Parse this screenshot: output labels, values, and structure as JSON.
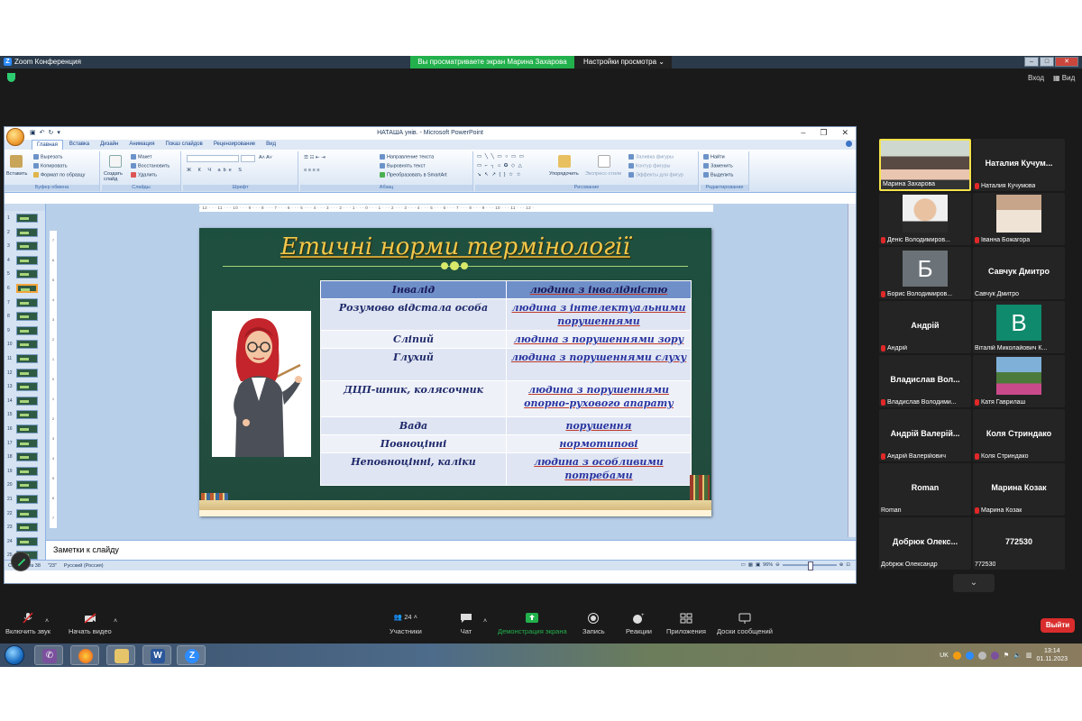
{
  "zoom": {
    "app_title": "Zoom Конференция",
    "share_banner": "Вы просматриваете экран Марина Захарова",
    "view_settings": "Настройки просмотра",
    "view_label": "Вход",
    "grid_label": "Вид"
  },
  "ppt": {
    "window_title": "НАТАША унів. - Microsoft PowerPoint",
    "tabs": [
      "Главная",
      "Вставка",
      "Дизайн",
      "Анимация",
      "Показ слайдов",
      "Рецензирование",
      "Вид"
    ],
    "ribbon": {
      "paste": "Вставить",
      "cut": "Вырезать",
      "copy": "Копировать",
      "format_painter": "Формат по образцу",
      "clipboard_group": "Буфер обмена",
      "new_slide": "Создать слайд",
      "layout": "Макет",
      "reset": "Восстановить",
      "delete": "Удалить",
      "slides_group": "Слайды",
      "font_group": "Шрифт",
      "text_direction": "Направление текста",
      "align_text": "Выровнять текст",
      "smartart": "Преобразовать в SmartArt",
      "paragraph_group": "Абзац",
      "arrange": "Упорядочить",
      "quick_styles": "Экспресс-стили",
      "shape_fill": "Заливка фигуры",
      "shape_outline": "Контур фигуры",
      "shape_effects": "Эффекты для фигур",
      "drawing_group": "Рисование",
      "find": "Найти",
      "replace": "Заменить",
      "select": "Выделить",
      "editing_group": "Редактирование"
    },
    "hruler_text": "· 12 · · · 11 · · · 10 · · · 9 · · · 8 · · · 7 · · · 6 · · · 5 · · · 4 · · · 3 · · · 2 · · · 1 · · · 0 · · · 1 · · · 2 · · · 3 · · · 4 · · · 5 · · · 6 · · · 7 · · · 8 · · · 9 · · · 10 · · · 11 · · · 12 ·",
    "thumbnails": [
      "1",
      "2",
      "3",
      "4",
      "5",
      "6",
      "7",
      "8",
      "9",
      "10",
      "11",
      "12",
      "13",
      "14",
      "15",
      "16",
      "17",
      "18",
      "19",
      "20",
      "21",
      "22",
      "23",
      "24",
      "25"
    ],
    "active_thumbnail": "6",
    "slide": {
      "title": "Етичні норми термінології",
      "table": [
        [
          "Інвалід",
          "людина з інвалідністю"
        ],
        [
          "Розумово  відстала особа",
          "людина з інтелектуальними порушеннями"
        ],
        [
          "Сліпий",
          "людина з порушеннями зору"
        ],
        [
          "Глухий",
          "людина з порушеннями слуху"
        ],
        [
          "ДЦП-шник,  колясочник",
          "людина з порушеннями опорно-рухового апарату"
        ],
        [
          "Вада",
          "порушення"
        ],
        [
          "Повноцінні",
          "нормотипові"
        ],
        [
          "Неповноцінні, каліки",
          "людина з особливими потребами"
        ]
      ]
    },
    "notes_placeholder": "Заметки к слайду",
    "status": {
      "slide_of": "Слайд 6 из 38",
      "theme": "\"23\"",
      "language": "Русский (Россия)",
      "zoom": "96%"
    }
  },
  "participants": [
    {
      "center": "",
      "label": "Марина Захарова",
      "muted": false,
      "kind": "photo",
      "active": true
    },
    {
      "center": "Наталия  Кучум...",
      "label": "Наталия Кучумова",
      "muted": true,
      "kind": "name"
    },
    {
      "center": "",
      "label": "Деніс Володимиров...",
      "muted": true,
      "kind": "photo2"
    },
    {
      "center": "",
      "label": "Іванна Божагора",
      "muted": true,
      "kind": "photo3"
    },
    {
      "center": "Б",
      "label": "Борис Володимиров...",
      "muted": true,
      "kind": "letter",
      "color": "#6b7278"
    },
    {
      "center": "Савчук Дмитро",
      "label": "Савчук Дмитро",
      "muted": false,
      "kind": "name"
    },
    {
      "center": "Андрій",
      "label": "Андрій",
      "muted": true,
      "kind": "name"
    },
    {
      "center": "В",
      "label": "Віталій Миколайович К...",
      "muted": false,
      "kind": "letter",
      "color": "#0f8a6c"
    },
    {
      "center": "Владислав  Вол...",
      "label": "Владислав Володими...",
      "muted": true,
      "kind": "name"
    },
    {
      "center": "",
      "label": "Катя Гаврилаш",
      "muted": true,
      "kind": "photo4"
    },
    {
      "center": "Андрій  Валерій...",
      "label": "Андрій Валерійович",
      "muted": true,
      "kind": "name"
    },
    {
      "center": "Коля  Стриндако",
      "label": "Коля Стриндако",
      "muted": true,
      "kind": "name"
    },
    {
      "center": "Roman",
      "label": "Roman",
      "muted": false,
      "kind": "name"
    },
    {
      "center": "Марина  Козак",
      "label": "Марина Козак",
      "muted": true,
      "kind": "name"
    },
    {
      "center": "Добрюк  Олекс...",
      "label": "Добрюк Олександр",
      "muted": false,
      "kind": "name"
    },
    {
      "center": "772530",
      "label": "772530",
      "muted": false,
      "kind": "name"
    }
  ],
  "toolbar": {
    "audio": "Включить звук",
    "video": "Начать видео",
    "participants": "Участники",
    "participants_count": "24",
    "chat": "Чат",
    "share": "Демонстрация экрана",
    "record": "Запись",
    "reactions": "Реакции",
    "apps": "Приложения",
    "whiteboard": "Доски сообщений",
    "leave": "Выйти"
  },
  "taskbar": {
    "lang": "UK",
    "time": "13:14",
    "date": "01.11.2023"
  },
  "colors": {
    "zoom_green": "#22b14c",
    "leave_red": "#d92c2c",
    "slide_title": "#f2c84b",
    "slide_bg": "#1d4f3f"
  }
}
